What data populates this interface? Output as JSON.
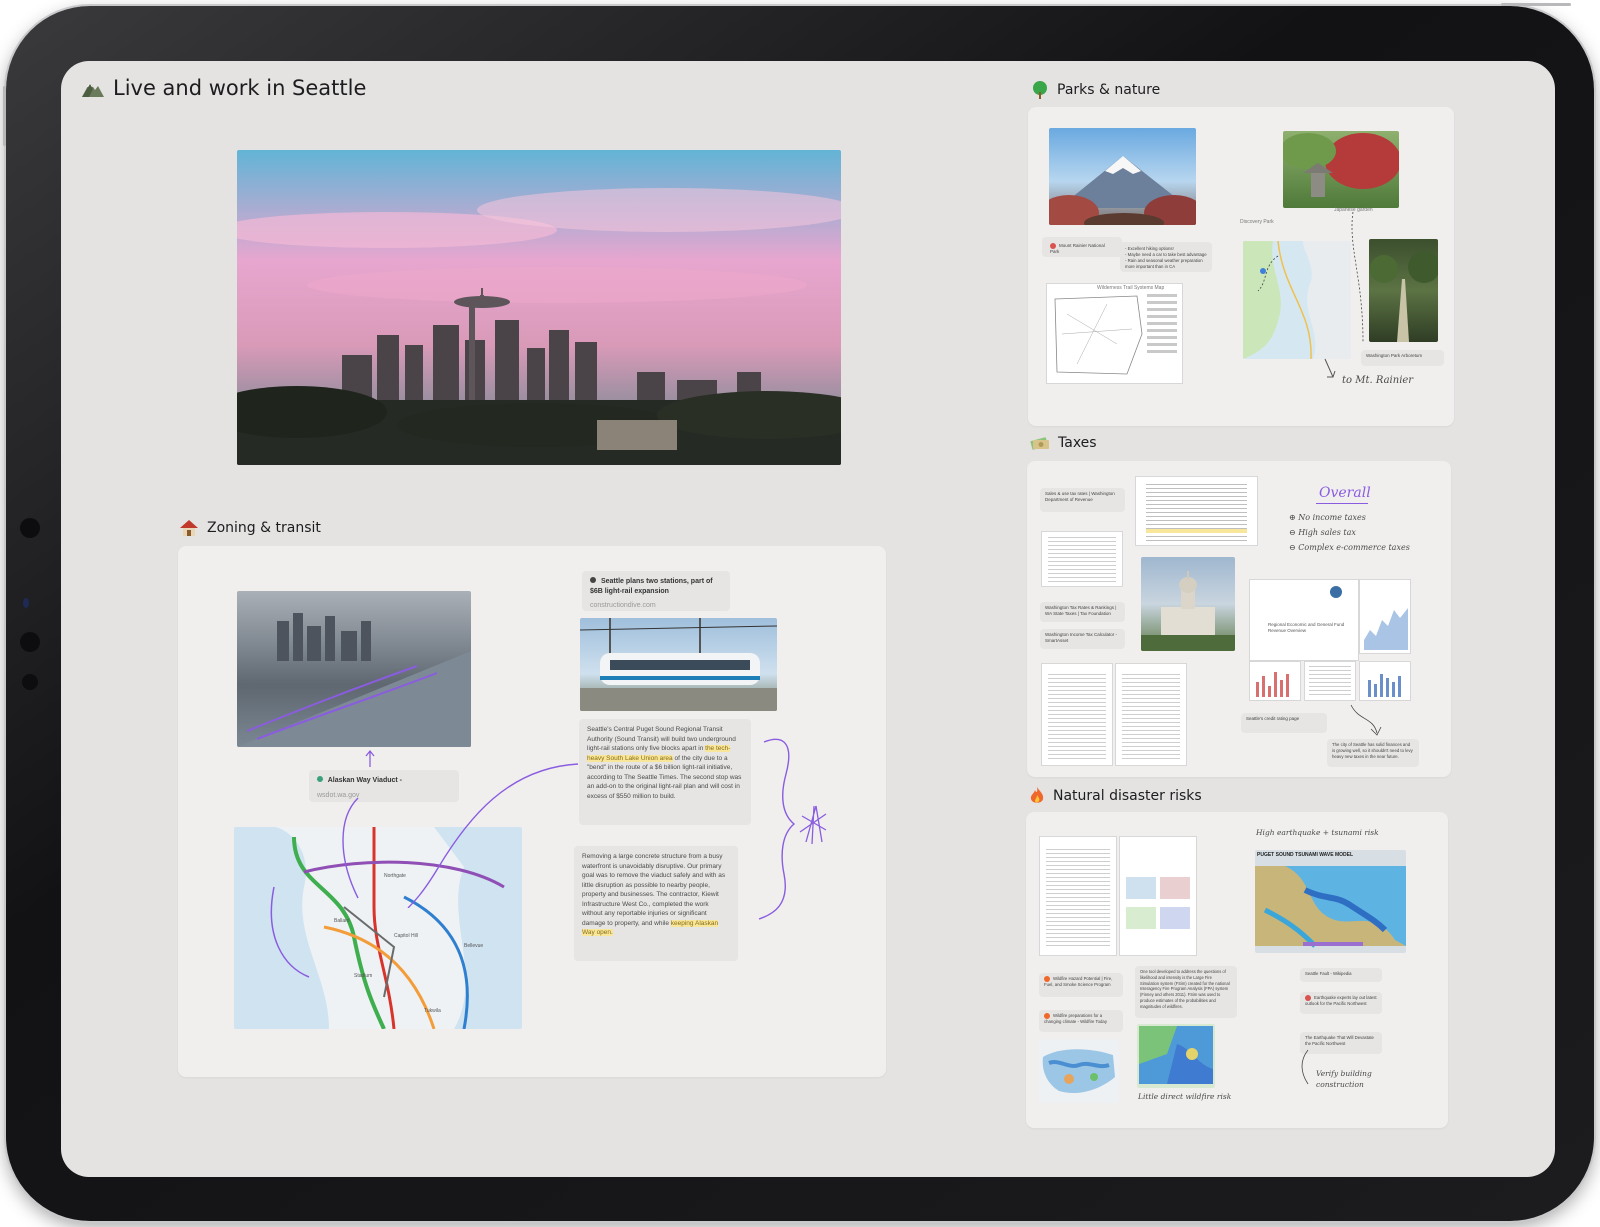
{
  "main": {
    "title": "Live and work in Seattle",
    "title_icon": "mountain-icon"
  },
  "zoning": {
    "title": "Zoning & transit",
    "title_icon": "house-icon",
    "article_card": {
      "title": "Seattle plans two stations, part of $6B light-rail expansion",
      "source": "constructiondive.com"
    },
    "viaduct_card": {
      "title": "Alaskan Way Viaduct -",
      "source": "wsdot.wa.gov"
    },
    "quote1_pre": "Seattle's Central Puget Sound Regional Transit Authority (Sound Transit) will build two underground light-rail stations only five blocks apart in ",
    "quote1_hl": "the tech-heavy South Lake Union area",
    "quote1_post": " of the city due to a \"bend\" in the route of a $6 billion light-rail initiative, according to The Seattle Times. The second stop was an add-on to the original light-rail plan and will cost in excess of $550 million to build.",
    "quote2_pre": "Removing a large concrete structure from a busy waterfront is unavoidably disruptive. Our primary goal was to remove the viaduct safely and with as little disruption as possible to nearby people, property and businesses. The contractor, Kiewit Infrastructure West Co., completed the work without any reportable injuries or significant damage to property, and while ",
    "quote2_hl": "keeping Alaskan Way open."
  },
  "parks": {
    "title": "Parks & nature",
    "title_icon": "tree-icon",
    "rainier_label": "Mount Rainier National Park",
    "notes": [
      "- Excellent hiking options!",
      "- Maybe need a car to take best advantage",
      "- Rain and seasonal weather preparation more important than in CA"
    ],
    "discovery_label": "Discovery Park",
    "garden_label": "Japanese garden",
    "map_caption": "Wilderness Trail Systems Map",
    "arboretum_label": "Washington Park Arboretum",
    "handwriting": "to Mt. Rainier"
  },
  "taxes": {
    "title": "Taxes",
    "title_icon": "money-icon",
    "card1": "Sales & use tax rates | Washington Department of Revenue",
    "card2": "Washington Tax Rates & Rankings | WA State Taxes | Tax Foundation",
    "card3": "Washington Income Tax Calculator - SmartAsset",
    "card4": "Seattle's credit rating page",
    "report_title": "Regional Economic and General Fund Revenue Overview",
    "note": "The city of Seattle has solid finances and is growing well, so it shouldn't need to levy heavy new taxes in the near future.",
    "overall_title": "Overall",
    "overall_items": [
      "No income taxes",
      "High sales tax",
      "Complex e-commerce taxes"
    ]
  },
  "disaster": {
    "title": "Natural disaster risks",
    "title_icon": "fire-icon",
    "tsunami_title": "PUGET SOUND TSUNAMI WAVE MODEL",
    "hand_tsunami": "High earthquake + tsunami risk",
    "hand_wildfire": "Little direct wildfire risk",
    "hand_verify": "Verify building construction",
    "card_wildfire": "Wildfire Hazard Potential | Fire, Fuel, and Smoke Science Program",
    "card_prep": "Wildfire preparations for a changing climate - Wildfire Today",
    "card_fault": "Seattle Fault - Wikipedia",
    "card_quake": "Earthquake experts lay out latest outlook for the Pacific Northwest",
    "card_book": "The Earthquake That Will Devastate the Pacific Northwest",
    "wildfire_excerpt": "One tool developed to address the questions of likelihood and intensity is the Large Fire Simulation system (FSim) created for the national Interagency Fire Program Analysis (FPA) system (Finney and others 2011). FSim was used to produce estimates of the probabilities and magnitudes of wildfires."
  },
  "colors": {
    "screen_bg": "#e4e3e2",
    "board_bg": "#f0efee",
    "ink_purple": "#8a5ce0",
    "highlight": "#f8e69a"
  }
}
